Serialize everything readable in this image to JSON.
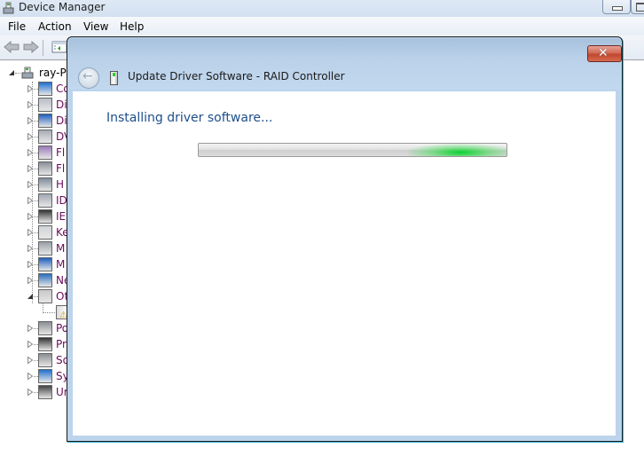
{
  "device_manager": {
    "title": "Device Manager",
    "menu": [
      "File",
      "Action",
      "View",
      "Help"
    ],
    "toolbar": {
      "back_icon": "back-arrow-icon",
      "forward_icon": "forward-arrow-icon",
      "properties_icon": "console-tree-icon"
    },
    "tree": {
      "root": {
        "label": "ray-P",
        "icon": "computer-icon",
        "expanded": true
      },
      "items": [
        {
          "label": "Co",
          "icon": "computer-monitor-icon",
          "expanded": false
        },
        {
          "label": "Di",
          "icon": "disk-drive-icon",
          "expanded": false
        },
        {
          "label": "Di",
          "icon": "display-adapter-icon",
          "expanded": false
        },
        {
          "label": "DV",
          "icon": "dvd-drive-icon",
          "expanded": false
        },
        {
          "label": "Fl",
          "icon": "floppy-controller-icon",
          "expanded": false
        },
        {
          "label": "Fl",
          "icon": "floppy-drive-icon",
          "expanded": false
        },
        {
          "label": "H",
          "icon": "human-interface-icon",
          "expanded": false
        },
        {
          "label": "ID",
          "icon": "ide-controller-icon",
          "expanded": false
        },
        {
          "label": "IE",
          "icon": "ieee1394-icon",
          "expanded": false
        },
        {
          "label": "Ke",
          "icon": "keyboard-icon",
          "expanded": false
        },
        {
          "label": "M",
          "icon": "mouse-icon",
          "expanded": false
        },
        {
          "label": "M",
          "icon": "monitor-icon",
          "expanded": false
        },
        {
          "label": "Ne",
          "icon": "network-adapter-icon",
          "expanded": false
        },
        {
          "label": "Ot",
          "icon": "other-devices-icon",
          "expanded": true,
          "children": [
            {
              "label": "",
              "icon": "warning-device-icon"
            }
          ]
        },
        {
          "label": "Po",
          "icon": "ports-icon",
          "expanded": false
        },
        {
          "label": "Pr",
          "icon": "processor-icon",
          "expanded": false
        },
        {
          "label": "So",
          "icon": "sound-icon",
          "expanded": false
        },
        {
          "label": "Sy",
          "icon": "system-devices-icon",
          "expanded": false
        },
        {
          "label": "Ur",
          "icon": "usb-controller-icon",
          "expanded": false
        }
      ]
    }
  },
  "dialog": {
    "title": "Update Driver Software - RAID Controller",
    "heading": "Installing driver software...",
    "progress": {
      "state": "indeterminate",
      "marquee_position": 0.85
    },
    "close_label": "✕",
    "back_label": "←",
    "colors": {
      "heading": "#1e4e8c",
      "progress_glow": "#00d228",
      "frame": "#bcd4ec"
    }
  }
}
